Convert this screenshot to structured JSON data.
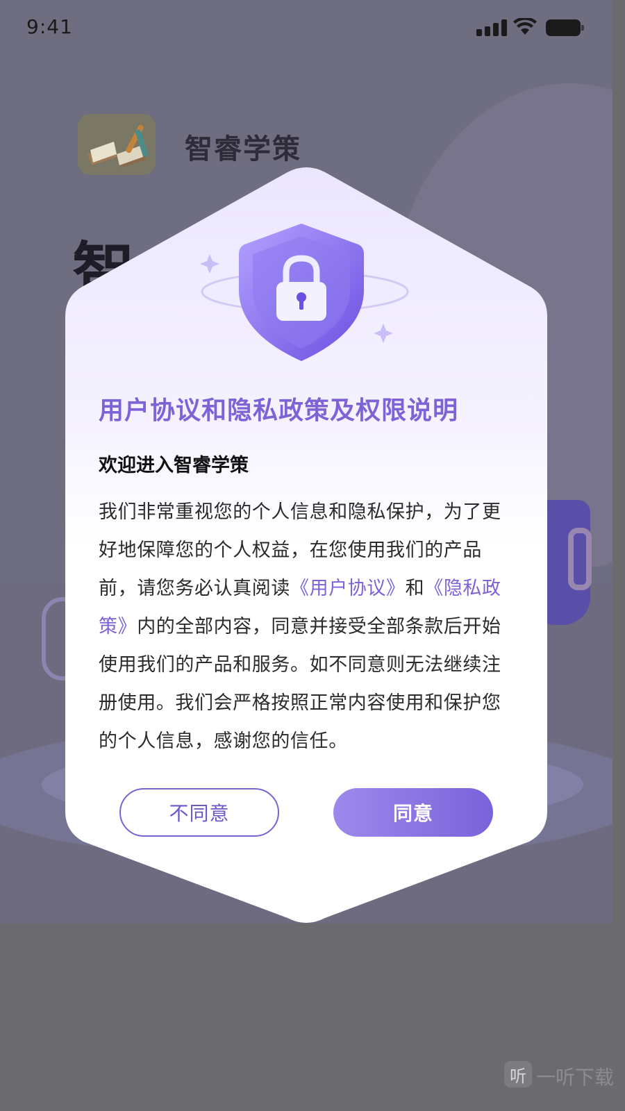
{
  "status_bar": {
    "time": "9:41"
  },
  "app": {
    "name": "智睿学策",
    "heading": "智"
  },
  "dialog": {
    "title": "用户协议和隐私政策及权限说明",
    "welcome": "欢迎进入智睿学策",
    "body": {
      "part1": "我们非常重视您的个人信息和隐私保护，为了更好地保障您的个人权益，在您使用我们的产品前，请您务必认真阅读",
      "user_agreement_link": "《用户协议》",
      "and": "和",
      "privacy_policy_link": "《隐私政策》",
      "part2": "内的全部内容，同意并接受全部条款后开始使用我们的产品和服务。如不同意则无法继续注册使用。我们会严格按照正常内容使用和保护您的个人信息，感谢您的信任。"
    },
    "disagree_label": "不同意",
    "agree_label": "同意"
  },
  "watermark": {
    "icon_text": "听",
    "text": "一听下载"
  },
  "colors": {
    "accent": "#7d63d6",
    "button_gradient_start": "#9d89ec",
    "button_gradient_end": "#7a62da"
  }
}
